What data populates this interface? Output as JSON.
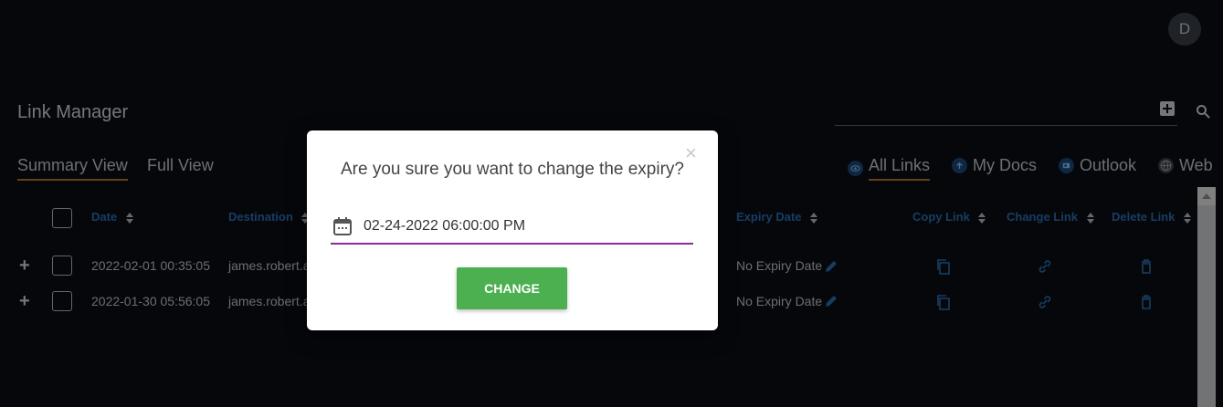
{
  "user": {
    "avatar_initial": "D"
  },
  "page": {
    "title": "Link Manager"
  },
  "view_tabs": [
    {
      "label": "Summary View",
      "active": true
    },
    {
      "label": "Full View",
      "active": false
    }
  ],
  "filters": [
    {
      "label": "All Links",
      "icon": "eye-icon",
      "active": true
    },
    {
      "label": "My Docs",
      "icon": "upload-icon",
      "active": false
    },
    {
      "label": "Outlook",
      "icon": "outlook-icon",
      "active": false
    },
    {
      "label": "Web",
      "icon": "globe-icon",
      "active": false
    }
  ],
  "table": {
    "headers": {
      "date": "Date",
      "destination": "Destination",
      "expiry": "Expiry Date",
      "copy": "Copy Link",
      "change": "Change Link",
      "delete": "Delete Link"
    },
    "rows": [
      {
        "date": "2022-02-01 00:35:05",
        "destination": "james.robert.a",
        "expiry": "No Expiry Date"
      },
      {
        "date": "2022-01-30 05:56:05",
        "destination": "james.robert.a",
        "expiry": "No Expiry Date"
      }
    ]
  },
  "modal": {
    "message": "Are you sure you want to change the expiry?",
    "date_value": "02-24-2022 06:00:00 PM",
    "button_label": "CHANGE"
  },
  "colors": {
    "background": "#0a0d14",
    "accent_underline": "#b8762e",
    "header_blue": "#2c6fb5",
    "button_green": "#4caf50",
    "input_underline": "#8e2a96"
  }
}
